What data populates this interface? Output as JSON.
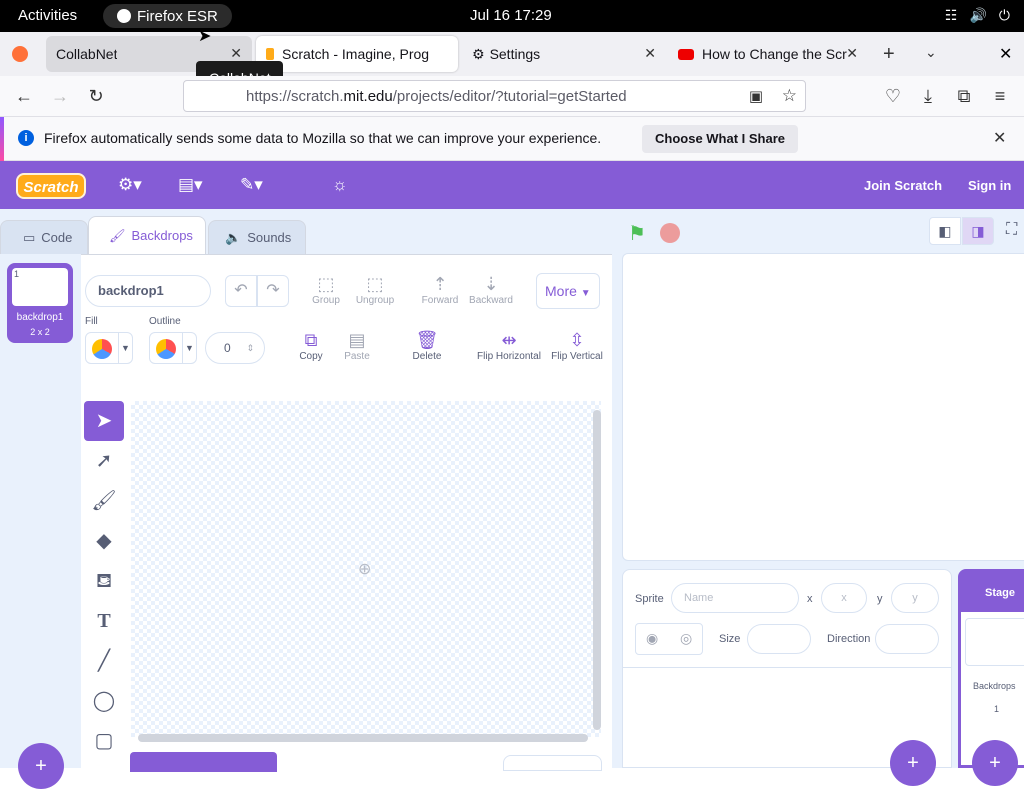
{
  "gnome": {
    "activities": "Activities",
    "app_name": "Firefox ESR",
    "clock": "Jul 16  17:29"
  },
  "tabs": [
    {
      "label": "CollabNet"
    },
    {
      "label": "Scratch - Imagine, Prog"
    },
    {
      "label": "Settings"
    },
    {
      "label": "How to Change the Scr"
    }
  ],
  "tooltip": "CollabNet",
  "url": {
    "prefix": "https://scratch.",
    "domain": "mit.edu",
    "path": "/projects/editor/?tutorial=getStarted"
  },
  "notification": {
    "message": "Firefox automatically sends some data to Mozilla so that we can improve your experience.",
    "button": "Choose What I Share"
  },
  "scratch": {
    "logo": "Scratch",
    "join": "Join Scratch",
    "signin": "Sign in",
    "editor_tabs": [
      "Code",
      "Backdrops",
      "Sounds"
    ],
    "costume": {
      "num": "1",
      "name": "backdrop1",
      "size": "2 x 2"
    },
    "costume_name_value": "backdrop1",
    "toolbar": {
      "group": "Group",
      "ungroup": "Ungroup",
      "forward": "Forward",
      "backward": "Backward",
      "more": "More",
      "copy": "Copy",
      "paste": "Paste",
      "delete": "Delete",
      "flip_h": "Flip Horizontal",
      "flip_v": "Flip Vertical"
    },
    "fill_label": "Fill",
    "outline_label": "Outline",
    "outline_width": "0",
    "sprite_info": {
      "sprite_label": "Sprite",
      "name_placeholder": "Name",
      "x_label": "x",
      "x_placeholder": "x",
      "y_label": "y",
      "y_placeholder": "y",
      "size_label": "Size",
      "direction_label": "Direction"
    },
    "stage_panel": {
      "title": "Stage",
      "backdrops_label": "Backdrops",
      "backdrops_count": "1"
    }
  },
  "colors": {
    "scratch_purple": "#855cd6",
    "editor_bg": "#e9f1fc"
  }
}
